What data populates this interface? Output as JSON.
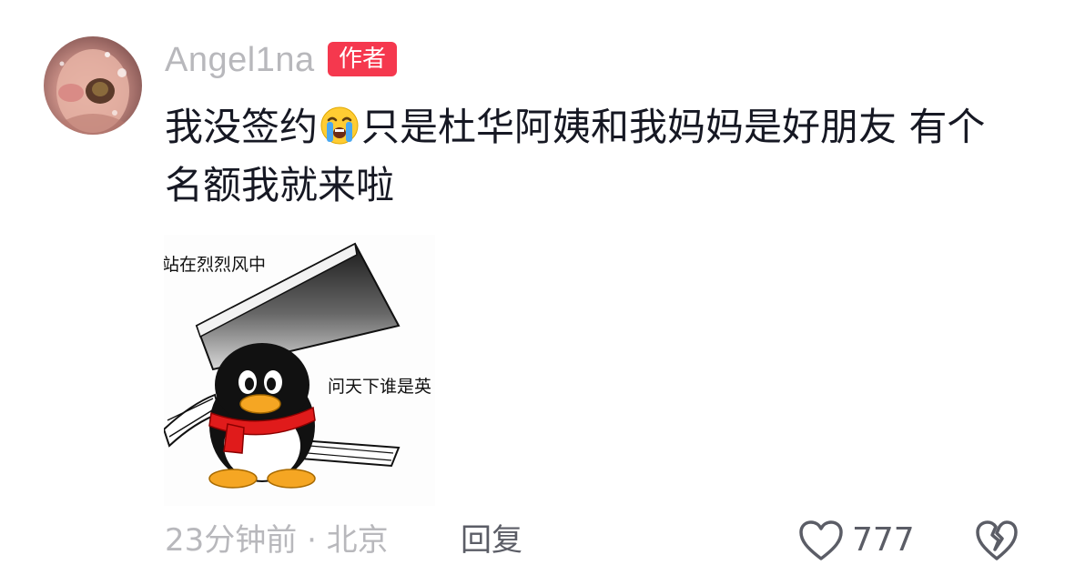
{
  "comment": {
    "username": "Angel1na",
    "author_badge": "作者",
    "text_part1": "我没签约",
    "emoji": "loudly-crying-face-emoji",
    "text_part2": "只是杜华阿姨和我妈妈是好朋友 有个名额我就来啦",
    "sticker": {
      "caption_top": "站在烈烈风中",
      "caption_right": "问天下谁是英",
      "icon": "penguin-with-cleaver-sticker"
    },
    "meta": "23分钟前 · 北京",
    "reply_label": "回复",
    "like_count": "777"
  },
  "colors": {
    "badge_bg": "#f5384e",
    "username": "#b8b8bc",
    "text": "#161823",
    "meta": "#b8b8bc",
    "action": "#5b5d66"
  }
}
